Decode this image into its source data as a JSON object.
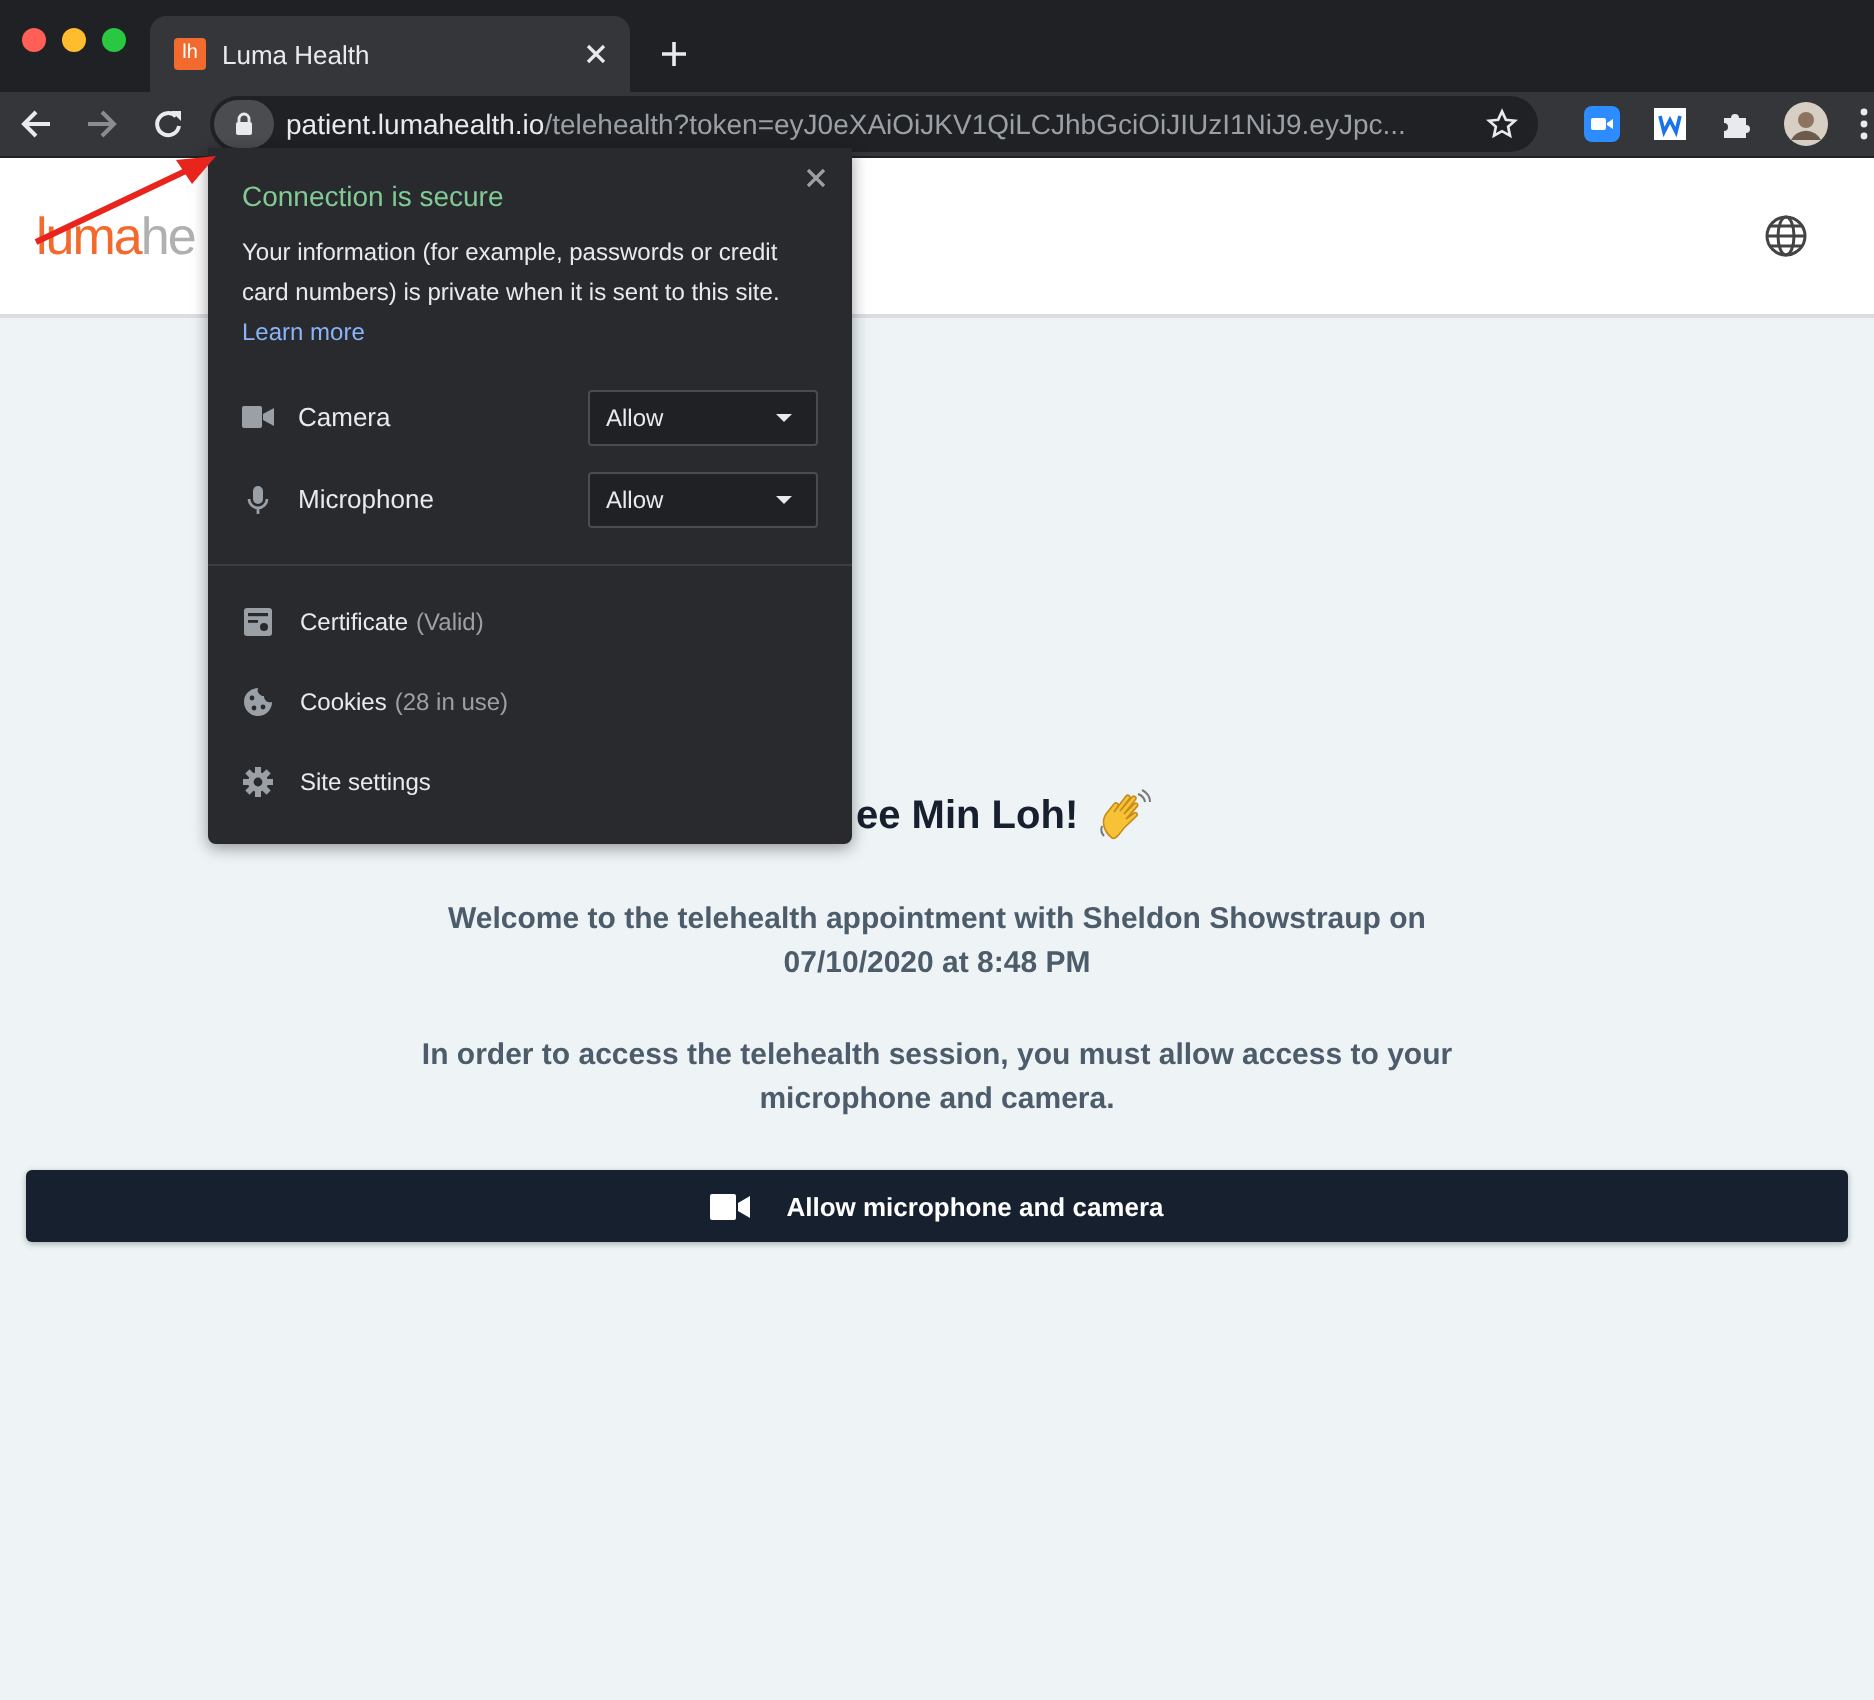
{
  "browser": {
    "tab": {
      "favicon": "lh",
      "title": "Luma Health",
      "selected": true
    },
    "address": {
      "host": "patient.lumahealth.io",
      "path": "/telehealth?token=eyJ0eXAiOiJKV1QiLCJhbGciOiJIUzI1NiJ9.eyJpc..."
    }
  },
  "site_info": {
    "title": "Connection is secure",
    "description": "Your information (for example, passwords or credit card numbers) is private when it is sent to this site.",
    "link": "Learn more",
    "permissions": [
      {
        "kind": "camera",
        "name": "Camera",
        "value": "Allow"
      },
      {
        "kind": "microphone",
        "name": "Microphone",
        "value": "Allow"
      }
    ],
    "links": [
      {
        "kind": "certificate",
        "label": "Certificate",
        "detail": "(Valid)"
      },
      {
        "kind": "cookies",
        "label": "Cookies",
        "detail": "(28 in use)"
      },
      {
        "kind": "settings",
        "label": "Site settings"
      }
    ]
  },
  "page": {
    "logo": {
      "brand": "luma",
      "rest": "he"
    },
    "heading": "ee Min Loh!",
    "messages": [
      "Welcome to the telehealth appointment with Sheldon Showstraup on 07/10/2020 at 8:48 PM",
      "In order to access the telehealth session, you must allow access to your microphone and camera."
    ],
    "button": "Allow microphone and camera"
  }
}
